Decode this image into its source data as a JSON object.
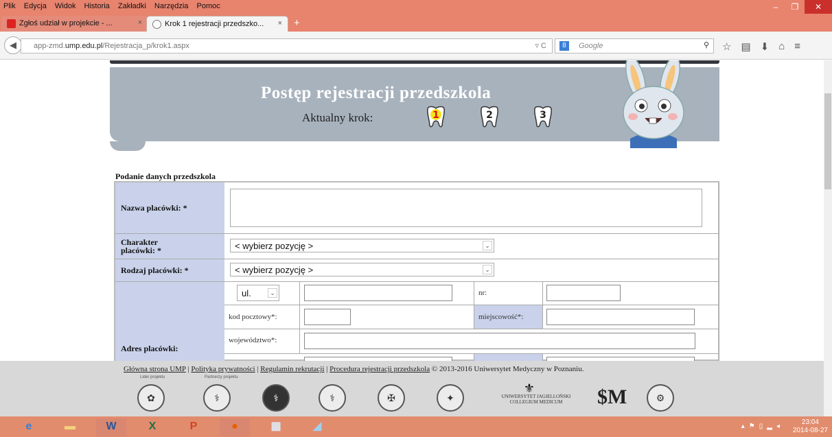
{
  "browser": {
    "menu": [
      "Plik",
      "Edycja",
      "Widok",
      "Historia",
      "Zakładki",
      "Narzędzia",
      "Pomoc"
    ],
    "tabs": [
      {
        "label": "Zgłoś udział w projekcie - ...",
        "close": "×"
      },
      {
        "label": "Krok 1 rejestracji przedszko...",
        "close": "×"
      }
    ],
    "new_tab": "+",
    "url_host": "app-zmd.",
    "url_domain": "ump.edu.pl",
    "url_path": "/Rejestracja_p/krok1.aspx",
    "search_placeholder": "Google",
    "search_engine_badge": "8"
  },
  "banner": {
    "title": "Postęp rejestracji przedszkola",
    "current_step_label": "Aktualny krok:",
    "steps": [
      "1",
      "2",
      "3"
    ],
    "active_step": 1
  },
  "form": {
    "section_title": "Podanie danych przedszkola",
    "fields": {
      "nazwa_label": "Nazwa placówki: *",
      "charakter_label_line1": "Charakter",
      "charakter_label_line2": "placówki: *",
      "charakter_value": "< wybierz pozycję >",
      "rodzaj_label": "Rodzaj placówki: *",
      "rodzaj_value": "< wybierz pozycję >",
      "adres_label": "Adres placówki:",
      "street_prefix": "ul.",
      "nr_label": "nr:",
      "kod_label": "kod pocztowy*:",
      "miejscowosc_label": "miejscowość*:",
      "wojewodztwo_label": "województwo*:"
    }
  },
  "footer": {
    "links": [
      "Główna strona UMP",
      "Polityka prywatności",
      "Regulamin rekrutacji",
      "Procedura rejestracji przedszkola"
    ],
    "separator": "|",
    "copyright": "© 2013-2016 Uniwersytet Medyczny w Poznaniu.",
    "lider_label": "Lider projektu",
    "partnerzy_label": "Partnerzy projektu",
    "uj_line1": "UNIWERSYTET JAGIELLOŃSKI",
    "uj_line2": "COLLEGIUM MEDICUM",
    "sum_logo": "$M"
  },
  "taskbar": {
    "time": "23:04",
    "date": "2014-08-27"
  }
}
